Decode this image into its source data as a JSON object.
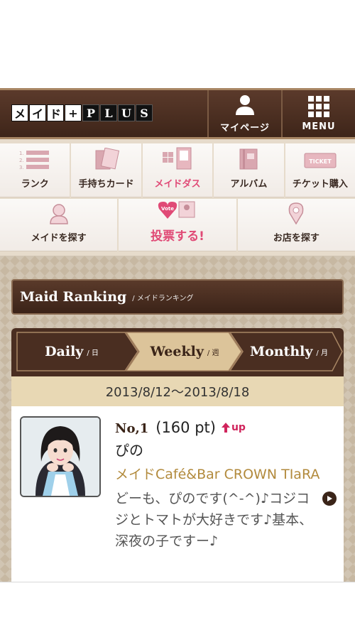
{
  "header": {
    "logo_chars": [
      "メ",
      "イ",
      "ド",
      "+",
      "P",
      "L",
      "U",
      "S"
    ],
    "mypage_label": "マイページ",
    "menu_label": "MENU"
  },
  "nav": {
    "row1": [
      {
        "label": "ランク",
        "icon": "rank-list-icon"
      },
      {
        "label": "手持ちカード",
        "icon": "cards-icon"
      },
      {
        "label": "メイドダス",
        "icon": "maid-dus-icon",
        "highlight": true
      },
      {
        "label": "アルバム",
        "icon": "album-icon"
      },
      {
        "label": "チケット購入",
        "icon": "ticket-icon",
        "icon_text": "TICKET"
      }
    ],
    "row2": [
      {
        "label": "メイドを探す",
        "icon": "maid-search-icon"
      },
      {
        "label": "投票する!",
        "icon": "vote-icon",
        "icon_text": "Vote",
        "highlight": true
      },
      {
        "label": "お店を探す",
        "icon": "location-pin-icon"
      }
    ]
  },
  "ranking": {
    "title": "Maid Ranking",
    "subtitle": "/ メイドランキング",
    "tabs": [
      {
        "label": "Daily",
        "sub": "/ 日",
        "active": false
      },
      {
        "label": "Weekly",
        "sub": "/ 週",
        "active": true
      },
      {
        "label": "Monthly",
        "sub": "/ 月",
        "active": false
      }
    ],
    "date_range": "2013/8/12〜2013/8/18",
    "entry": {
      "rank": "No,1",
      "points": "(160 pt)",
      "trend": "up",
      "name": "ぴの",
      "shop": "メイドCafé&Bar CROWN TIaRA",
      "description": "どーも、ぴのです(^-^)♪コジコジとトマトが大好きです♪基本、深夜の子ですー♪"
    }
  },
  "colors": {
    "brown_dark": "#3e2519",
    "pink": "#e04a76",
    "gold": "#b28a3c",
    "tan": "#e8d8b4"
  }
}
